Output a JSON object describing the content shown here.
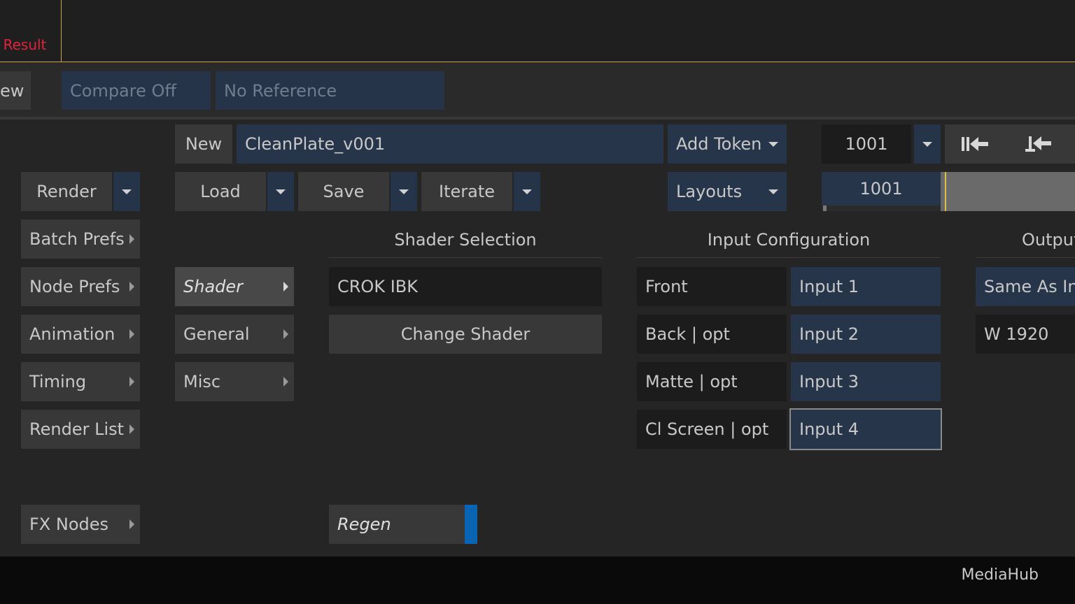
{
  "top": {
    "result_tab": "o Result"
  },
  "viewbar": {
    "view_label": "ew",
    "compare": "Compare Off",
    "reference": "No Reference"
  },
  "row1": {
    "new_label": "New",
    "name_value": "CleanPlate_v001",
    "add_token": "Add Token",
    "frame_value": "1001"
  },
  "row2": {
    "render": "Render",
    "load": "Load",
    "save": "Save",
    "iterate": "Iterate",
    "layouts": "Layouts",
    "frame_field": "1001"
  },
  "left_menu": [
    {
      "label": "Batch Prefs"
    },
    {
      "label": "Node Prefs"
    },
    {
      "label": "Animation"
    },
    {
      "label": "Timing"
    },
    {
      "label": "Render List"
    }
  ],
  "fx_nodes": "FX Nodes",
  "sub_menu": [
    {
      "label": "Shader"
    },
    {
      "label": "General"
    },
    {
      "label": "Misc"
    }
  ],
  "shader": {
    "header": "Shader Selection",
    "current": "CROK IBK",
    "change": "Change Shader",
    "regen": "Regen"
  },
  "input_config": {
    "header": "Input Configuration",
    "rows": [
      {
        "label": "Front",
        "value": "Input 1"
      },
      {
        "label": "Back | opt",
        "value": "Input 2"
      },
      {
        "label": "Matte | opt",
        "value": "Input 3"
      },
      {
        "label": "Cl Screen | opt",
        "value": "Input 4"
      }
    ]
  },
  "output": {
    "header": "Output",
    "resolution": "Same As In",
    "width": "W 1920"
  },
  "footer": {
    "app": "MediaHub"
  },
  "colors": {
    "accent_border": "#c9a24a",
    "result_red": "#e0243c",
    "regen_blue": "#0a64b4"
  }
}
